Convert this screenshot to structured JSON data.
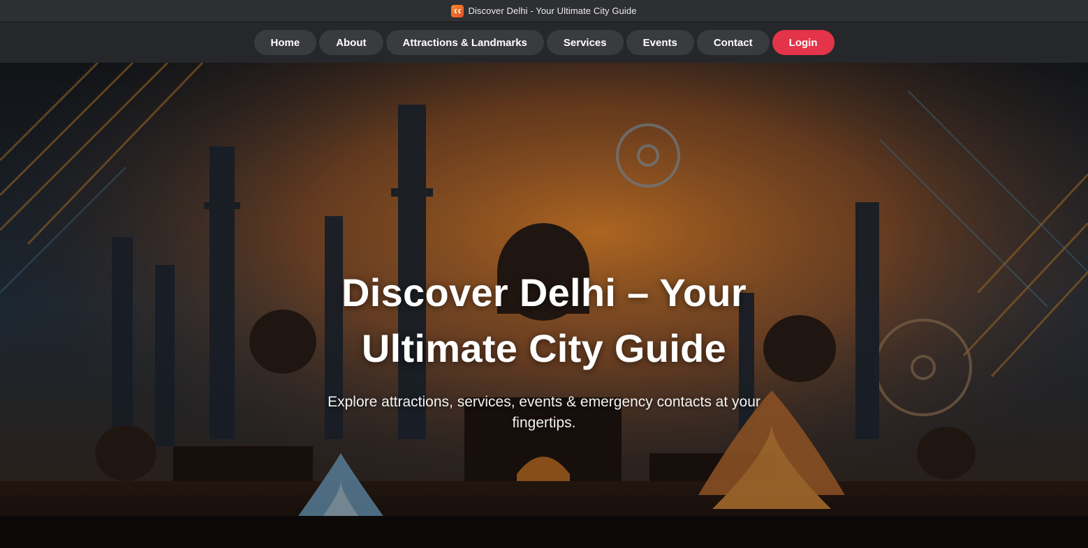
{
  "window": {
    "title": "Discover Delhi - Your Ultimate City Guide",
    "favicon_icon": "cc-logo-icon"
  },
  "nav": {
    "items": [
      {
        "label": "Home"
      },
      {
        "label": "About"
      },
      {
        "label": "Attractions & Landmarks"
      },
      {
        "label": "Services"
      },
      {
        "label": "Events"
      },
      {
        "label": "Contact"
      }
    ],
    "login_label": "Login"
  },
  "hero": {
    "title": "Discover Delhi – Your Ultimate City Guide",
    "subtitle": "Explore attractions, services, events & emergency contacts at your fingertips."
  },
  "colors": {
    "titlebar_bg": "#2e2f32",
    "navbar_bg": "#26272a",
    "nav_pill_bg": "#3a3b3e",
    "login_accent": "#e3344a",
    "hero_glow": "#e8862a"
  }
}
